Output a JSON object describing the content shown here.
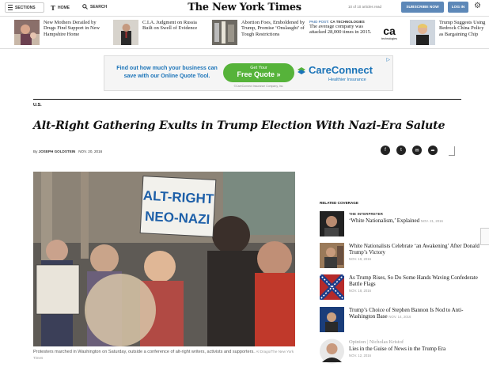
{
  "topbar": {
    "sections_label": "SECTIONS",
    "home_label": "HOME",
    "search_label": "SEARCH",
    "masthead": "The New York Times",
    "articles_read": "10 of 10 articles read",
    "subscribe_label": "SUBSCRIBE NOW",
    "login_label": "LOG IN"
  },
  "ribbon": {
    "items": [
      {
        "text": "New Mothers Derailed by Drugs Find Support in New Hampshire Home"
      },
      {
        "text": "C.I.A. Judgment on Russia Built on Swell of Evidence"
      },
      {
        "text": "Abortion Foes, Emboldened by Trump, Promise ‘Onslaught’ of Tough Restrictions"
      },
      {
        "label": "PAID POST:",
        "sponsor": "CA TECHNOLOGIES",
        "text": "The average company was attacked 28,000 times in 2015."
      },
      {
        "text": "Trump Suggests Using Bedrock China Policy as Bargaining Chip"
      }
    ]
  },
  "ad": {
    "text": "Find out how much your business can save with our Online Quote Tool.",
    "button_line1": "Get Your",
    "button_line2": "Free Quote",
    "arrow": "»",
    "small": "©CareConnect Insurance Company, Inc.",
    "brand": "CareConnect",
    "brand_sub": "Healthier Insurance"
  },
  "article": {
    "section": "U.S.",
    "headline": "Alt-Right Gathering Exults in Trump Election With Nazi-Era Salute",
    "byline_prefix": "By",
    "author": "JOSEPH GOLDSTEIN",
    "date": "NOV. 20, 2016",
    "sign_text_1": "ALT-RIGHT",
    "sign_text_2": "NEO-NAZI",
    "caption": "Protesters marched in Washington on Saturday, outside a conference of alt-right writers, activists and supporters.",
    "credit": "Al Drago/The New York Times"
  },
  "related": {
    "title": "RELATED COVERAGE",
    "items": [
      {
        "kicker": "THE INTERPRETER",
        "title": "‘White Nationalism,’ Explained",
        "date": "NOV. 21, 2016"
      },
      {
        "title": "White Nationalists Celebrate ‘an Awakening’ After Donald Trump’s Victory",
        "date": "NOV. 19, 2016"
      },
      {
        "title": "As Trump Rises, So Do Some Hands Waving Confederate Battle Flags",
        "date": "NOV. 18, 2016"
      },
      {
        "title": "Trump’s Choice of Stephen Bannon Is Nod to Anti-Washington Base",
        "date": "NOV. 14, 2016"
      },
      {
        "opinion": "Opinion",
        "author": "Nicholas Kristof",
        "title": "Lies in the Guise of News in the Trump Era",
        "date": "NOV. 12, 2016"
      }
    ]
  },
  "colors": {
    "accent": "#5d88b8",
    "ad_green": "#56b33a",
    "ad_blue": "#1a73b8"
  }
}
